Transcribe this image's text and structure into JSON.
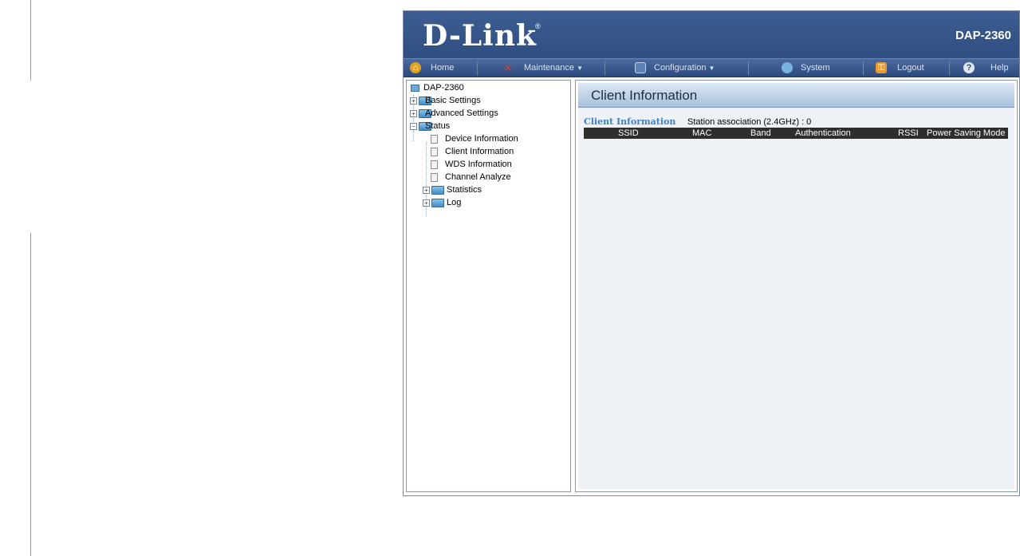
{
  "header": {
    "logo": "D-Link",
    "logo_mark": "®",
    "model": "DAP-2360"
  },
  "menu": {
    "home": "Home",
    "maintenance": "Maintenance",
    "configuration": "Configuration",
    "system": "System",
    "logout": "Logout",
    "help": "Help",
    "dropdown_caret": "▼"
  },
  "tree": {
    "root": "DAP-2360",
    "basic_settings": "Basic Settings",
    "advanced_settings": "Advanced Settings",
    "status": "Status",
    "device_information": "Device Information",
    "client_information": "Client Information",
    "wds_information": "WDS Information",
    "channel_analyze": "Channel Analyze",
    "statistics": "Statistics",
    "log": "Log",
    "expand_symbol": "+",
    "collapse_symbol": "−"
  },
  "content": {
    "title": "Client Information",
    "section_label": "Client Information",
    "station_association": "Station association (2.4GHz) :  0",
    "columns": [
      "SSID",
      "MAC",
      "Band",
      "Authentication",
      "RSSI",
      "Power Saving Mode"
    ]
  },
  "colors": {
    "banner": "#2f4e82",
    "section_label": "#3f7fc2",
    "header_row": "#2e2e2e"
  },
  "icons": {
    "home": "home-icon",
    "maintenance": "tools-icon",
    "configuration": "save-disk-icon",
    "system": "system-icon",
    "logout": "key-icon",
    "help": "help-icon"
  }
}
